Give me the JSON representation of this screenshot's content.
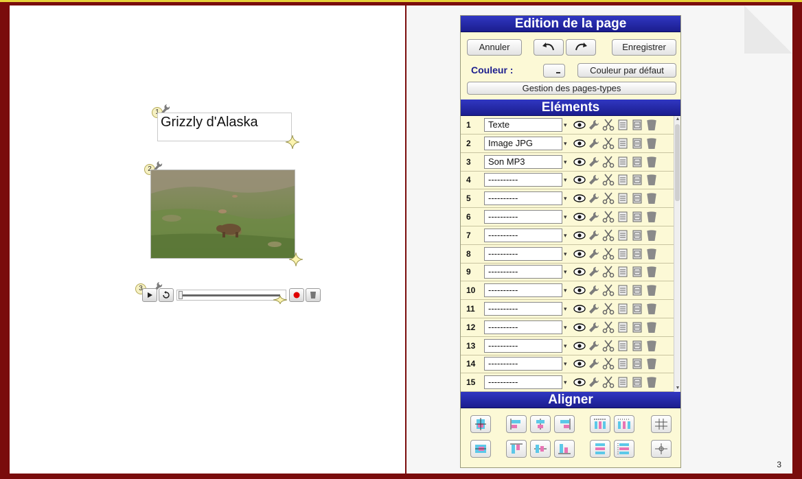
{
  "canvas": {
    "element1_title": "Grizzly d'Alaska",
    "badges": [
      "1",
      "2",
      "3"
    ],
    "page_number": "3"
  },
  "panel": {
    "title": "Edition de la page",
    "cancel_label": "Annuler",
    "save_label": "Enregistrer",
    "color_label": "Couleur :",
    "default_color_label": "Couleur par défaut",
    "templates_label": "Gestion des pages-types",
    "elements_title": "Eléments",
    "align_title": "Aligner"
  },
  "elements": [
    {
      "num": "1",
      "type": "Texte"
    },
    {
      "num": "2",
      "type": "Image JPG"
    },
    {
      "num": "3",
      "type": "Son MP3"
    },
    {
      "num": "4",
      "type": "----------"
    },
    {
      "num": "5",
      "type": "----------"
    },
    {
      "num": "6",
      "type": "----------"
    },
    {
      "num": "7",
      "type": "----------"
    },
    {
      "num": "8",
      "type": "----------"
    },
    {
      "num": "9",
      "type": "----------"
    },
    {
      "num": "10",
      "type": "----------"
    },
    {
      "num": "11",
      "type": "----------"
    },
    {
      "num": "12",
      "type": "----------"
    },
    {
      "num": "13",
      "type": "----------"
    },
    {
      "num": "14",
      "type": "----------"
    },
    {
      "num": "15",
      "type": "----------"
    }
  ],
  "colors": {
    "header_blue": "#1b1d8e",
    "panel_bg": "#fcf9d6",
    "frame_red": "#7a0c0c",
    "record_red": "#e00000"
  },
  "icons": [
    "eye-icon",
    "wrench-icon",
    "scissors-icon",
    "copy-icon",
    "paste-icon",
    "trash-icon"
  ]
}
